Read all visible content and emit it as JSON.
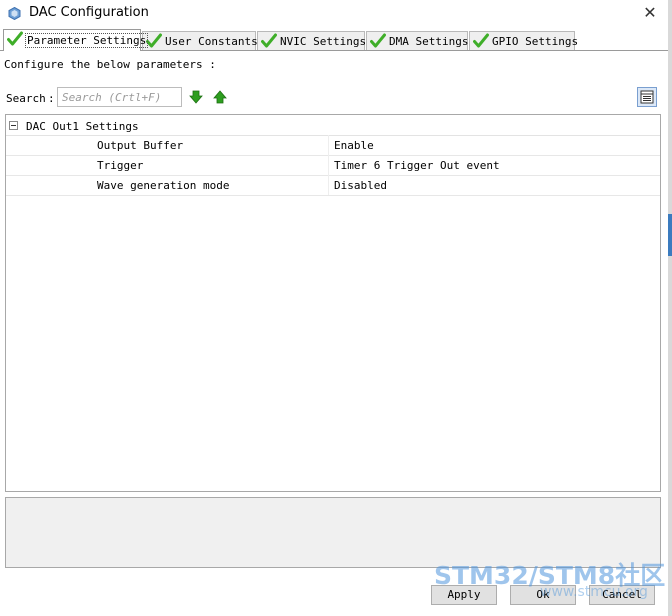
{
  "window": {
    "title": "DAC Configuration",
    "close_glyph": "✕"
  },
  "tabs": [
    {
      "label": "Parameter Settings",
      "active": true,
      "icon": "check-icon"
    },
    {
      "label": "User Constants",
      "active": false,
      "icon": "check-icon"
    },
    {
      "label": "NVIC Settings",
      "active": false,
      "icon": "check-icon"
    },
    {
      "label": "DMA Settings",
      "active": false,
      "icon": "check-icon"
    },
    {
      "label": "GPIO Settings",
      "active": false,
      "icon": "check-icon"
    }
  ],
  "instructions": "Configure the below parameters :",
  "search": {
    "label": "Search",
    "colon": ":",
    "placeholder": "Search (Crtl+F)"
  },
  "tree": {
    "group_label": "DAC Out1 Settings",
    "rows": [
      {
        "name": "Output Buffer",
        "value": "Enable"
      },
      {
        "name": "Trigger",
        "value": "Timer 6 Trigger Out event"
      },
      {
        "name": "Wave generation mode",
        "value": "Disabled"
      }
    ]
  },
  "buttons": {
    "apply": "Apply",
    "ok": "Ok",
    "cancel": "Cancel"
  },
  "watermark": {
    "text": "STM32/STM8社区",
    "url_text": "www.stmcu.org"
  },
  "colors": {
    "check_green": "#3fae29",
    "arrow_green": "#2e9e1f",
    "accent_blue": "#3b7bbf"
  }
}
